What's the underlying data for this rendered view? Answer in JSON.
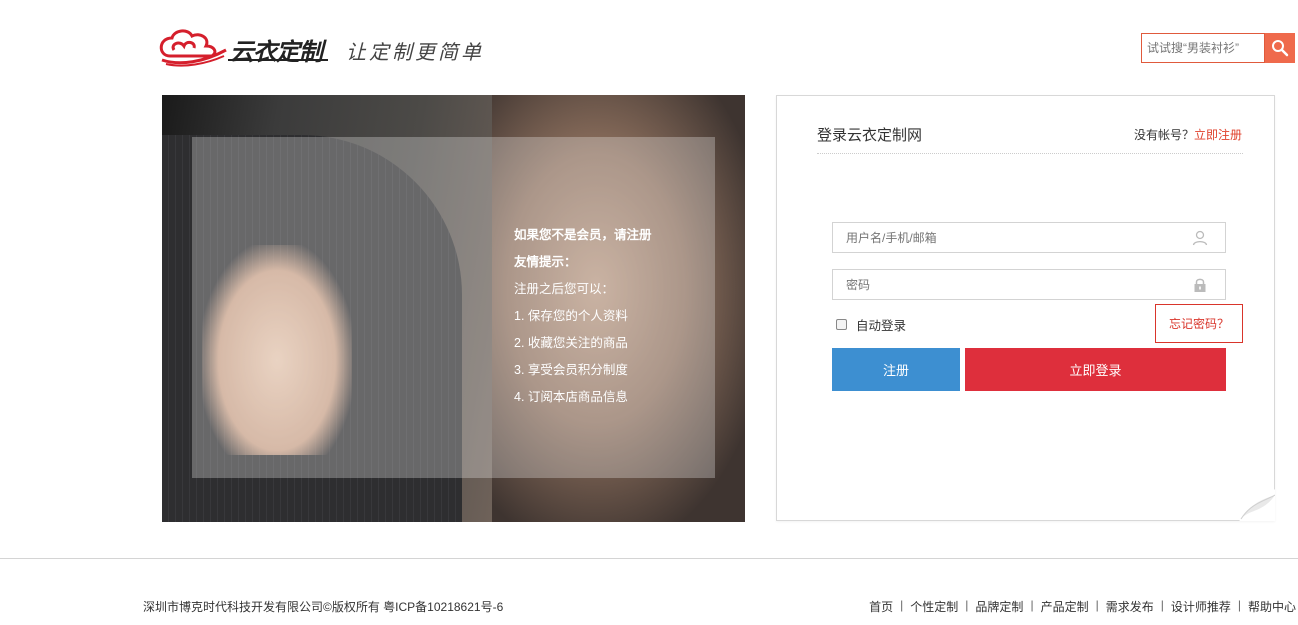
{
  "header": {
    "logo_name": "云衣定制",
    "slogan": "让定制更简单",
    "search_placeholder": "试试搜“男装衬衫”"
  },
  "hero": {
    "lines": [
      "如果您不是会员，请注册",
      "友情提示：",
      "注册之后您可以：",
      "1.  保存您的个人资料",
      "2.  收藏您关注的商品",
      "3.  享受会员积分制度",
      "4.  订阅本店商品信息"
    ]
  },
  "login": {
    "title": "登录云衣定制网",
    "no_account": "没有帐号？",
    "register_link": "立即注册",
    "username_placeholder": "用户名/手机/邮箱",
    "password_placeholder": "密码",
    "remember_label": "自动登录",
    "forgot_label": "忘记密码？",
    "register_button": "注册",
    "login_button": "立即登录"
  },
  "footer": {
    "copyright": "深圳市博克时代科技开发有限公司©版权所有 粤ICP备10218621号-6",
    "nav": [
      "首页",
      "个性定制",
      "品牌定制",
      "产品定制",
      "需求发布",
      "设计师推荐",
      "帮助中心"
    ]
  },
  "colors": {
    "accent_red": "#de2f3c",
    "accent_blue": "#3d8fd1",
    "search_orange": "#ef6a4c"
  }
}
